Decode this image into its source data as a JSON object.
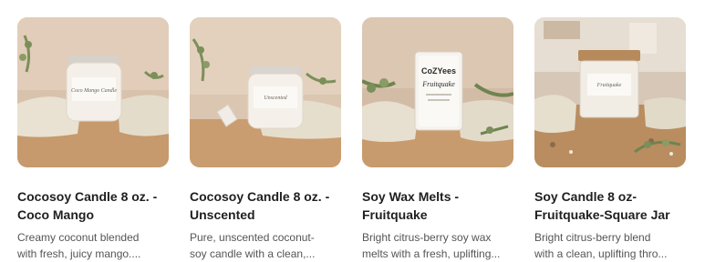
{
  "products": [
    {
      "title_line1": "Cocosoy Candle 8 oz. -",
      "title_line2": "Coco Mango",
      "desc_line1": "Creamy coconut blended",
      "desc_line2": "with fresh, juicy mango....",
      "jar_label": "Coco Mango Candle"
    },
    {
      "title_line1": "Cocosoy Candle 8 oz. -",
      "title_line2": "Unscented",
      "desc_line1": "Pure, unscented coconut-",
      "desc_line2": "soy candle with a clean,...",
      "jar_label": "Unscented"
    },
    {
      "title_line1": "Soy Wax Melts -",
      "title_line2": "Fruitquake",
      "desc_line1": "Bright citrus-berry soy wax",
      "desc_line2": "melts with a fresh, uplifting...",
      "brand_label": "CoZYees",
      "jar_label": "Fruitquake"
    },
    {
      "title_line1": "Soy Candle 8 oz-",
      "title_line2": "Fruitquake-Square Jar",
      "desc_line1": "Bright citrus-berry blend",
      "desc_line2": "with a clean, uplifting thro...",
      "jar_label": "Fruitquake"
    }
  ],
  "colors": {
    "wall": "#d9c3ae",
    "table": "#c99c6e",
    "linen": "#e6ddcc",
    "glass": "#f3efe8",
    "leaf": "#7c8f5a"
  }
}
